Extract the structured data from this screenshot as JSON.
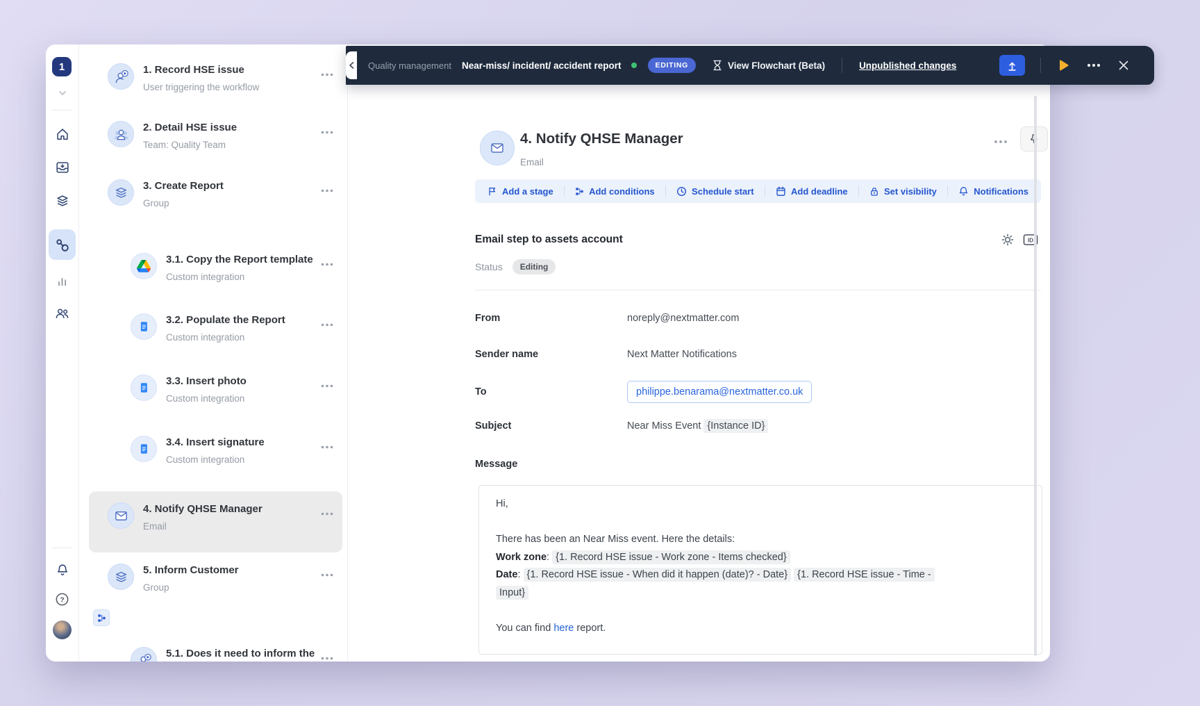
{
  "topbar": {
    "breadcrumb": "Quality management",
    "title": "Near-miss/ incident/ accident report",
    "status_badge": "EDITING",
    "view_flowchart": "View Flowchart (Beta)",
    "unpublished_changes": "Unpublished changes"
  },
  "rail": {
    "workspace_badge": "1"
  },
  "steps": [
    {
      "title": "1. Record HSE issue",
      "subtitle": "User triggering the workflow",
      "icon": "userplay",
      "indent": false,
      "selected": false
    },
    {
      "title": "2. Detail HSE issue",
      "subtitle": "Team: Quality Team",
      "icon": "users",
      "indent": false,
      "selected": false
    },
    {
      "title": "3. Create Report",
      "subtitle": "Group",
      "icon": "layers",
      "indent": false,
      "selected": false
    },
    {
      "title": "3.1. Copy the Report template",
      "subtitle": "Custom integration",
      "icon": "gdrive",
      "indent": true,
      "selected": false
    },
    {
      "title": "3.2. Populate the Report",
      "subtitle": "Custom integration",
      "icon": "gdoc",
      "indent": true,
      "selected": false
    },
    {
      "title": "3.3. Insert photo",
      "subtitle": "Custom integration",
      "icon": "gdoc",
      "indent": true,
      "selected": false
    },
    {
      "title": "3.4. Insert signature",
      "subtitle": "Custom integration",
      "icon": "gdoc",
      "indent": true,
      "selected": false
    },
    {
      "title": "4. Notify QHSE Manager",
      "subtitle": "Email",
      "icon": "envelope",
      "indent": false,
      "selected": true
    },
    {
      "title": "5. Inform Customer",
      "subtitle": "Group",
      "icon": "layers",
      "indent": false,
      "selected": false,
      "badge": "branch"
    },
    {
      "title": "5.1. Does it need to inform the",
      "subtitle": "",
      "icon": "userplay",
      "indent": true,
      "selected": false
    }
  ],
  "detail": {
    "title": "4. Notify QHSE Manager",
    "type_label": "Email",
    "toolbar": [
      {
        "icon": "flag",
        "label": "Add a stage"
      },
      {
        "icon": "branch",
        "label": "Add conditions"
      },
      {
        "icon": "clock",
        "label": "Schedule start"
      },
      {
        "icon": "calendar",
        "label": "Add deadline"
      },
      {
        "icon": "lock",
        "label": "Set visibility"
      },
      {
        "icon": "bell",
        "label": "Notifications"
      }
    ],
    "section_heading": "Email step to assets account",
    "status_label": "Status",
    "status_value": "Editing",
    "fields": {
      "from_label": "From",
      "from_value": "noreply@nextmatter.com",
      "sender_label": "Sender name",
      "sender_value": "Next Matter Notifications",
      "to_label": "To",
      "to_value": "philippe.benarama@nextmatter.co.uk",
      "subject_label": "Subject",
      "subject_text": "Near Miss Event",
      "subject_token": "{Instance ID}",
      "message_label": "Message"
    },
    "message": {
      "greeting": "Hi,",
      "intro": "There has been an Near Miss event. Here the details:",
      "work_zone_label": "Work zone",
      "work_zone_token": "{1. Record HSE issue - Work zone - Items checked}",
      "date_label": "Date",
      "date_token_1": "{1. Record HSE issue - When did it happen (date)? - Date}",
      "date_token_2_line_1": "{1. Record HSE issue - Time -",
      "date_token_2_line_2": "Input}",
      "closing_prefix": "You can find ",
      "closing_link": "here",
      "closing_suffix": " report."
    }
  },
  "colors": {
    "topbar_bg": "#1f2b3d",
    "accent_blue": "#2e5ee0",
    "editing_badge_bg": "#4a67d3",
    "link_blue": "#2563d6",
    "status_dot_green": "#3ec273",
    "play_yellow": "#f3b02c",
    "selected_row_bg": "#ebebec"
  }
}
